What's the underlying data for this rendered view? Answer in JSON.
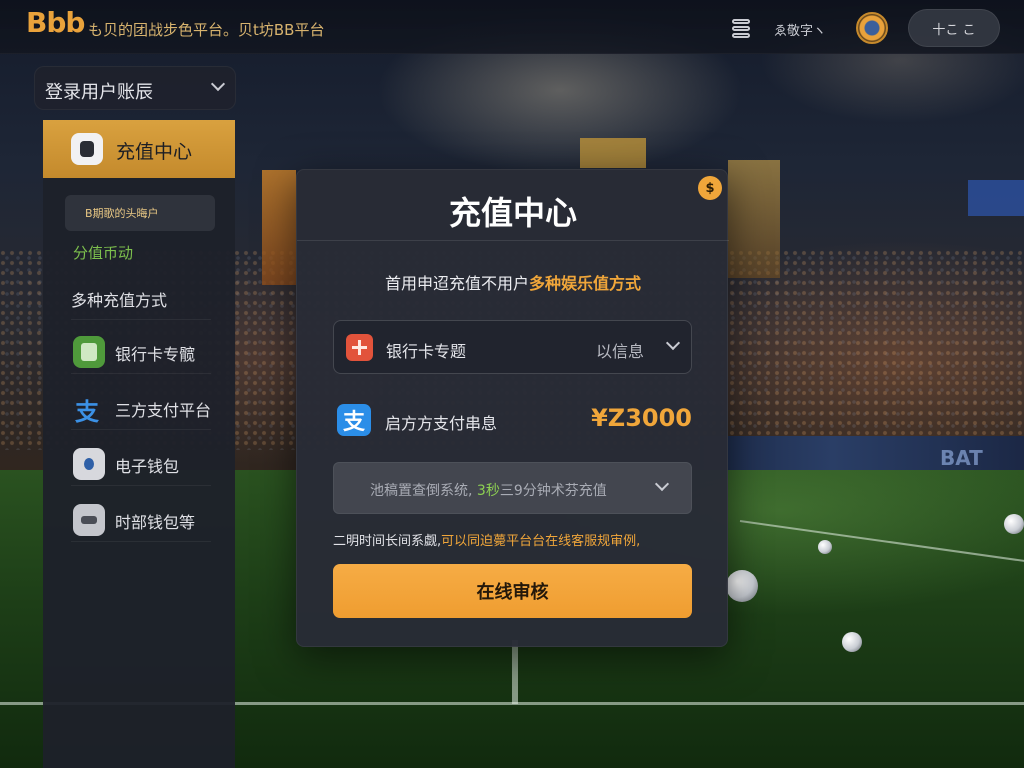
{
  "header": {
    "logo_text": "Bbb",
    "title": "も贝的团战步色平台。贝t坊BB平台",
    "language_label": "ゑ敬字ヽ",
    "user_pill": "十こ  こ"
  },
  "sidebar": {
    "account_dropdown_label": "登录用户账辰",
    "active_item": "充值中心",
    "small_card_text": "B期歌的头晦户",
    "sub_label": "分值币动",
    "items": [
      {
        "label": "多种充值方式",
        "icon": "card-list-icon"
      },
      {
        "label": "银行卡专髋",
        "icon": "bank-card-icon"
      },
      {
        "label": "三方支付平台",
        "icon": "alipay-icon"
      },
      {
        "label": "电子钱包",
        "icon": "wallet-icon"
      },
      {
        "label": "时部钱包等",
        "icon": "purse-icon"
      }
    ]
  },
  "modal": {
    "title": "充值中心",
    "close_icon_glyph": "$",
    "subtitle_prefix": "首用申迢充值不用户",
    "subtitle_highlight": "多种娱乐值方式",
    "bank_select_label": "银行卡专题",
    "bank_select_value": "以信息",
    "alipay_label": "启方方支付串息",
    "amount": "¥Z3000",
    "method_select_prefix": "池稿置查倒系统,",
    "method_select_green": "3秒",
    "method_select_suffix": "三9分钟术芬充值",
    "note_prefix": "二明时间长间系觑,",
    "note_highlight": "可以同迫薨平台台在线客服规审例,",
    "submit_button": "在线审核"
  },
  "background": {
    "ad_board_text": "BAT"
  },
  "colors": {
    "accent": "#f0a63a",
    "sidebar_active": "#d9a13f",
    "modal_bg": "#282b36",
    "green_text": "#8dcf52"
  }
}
